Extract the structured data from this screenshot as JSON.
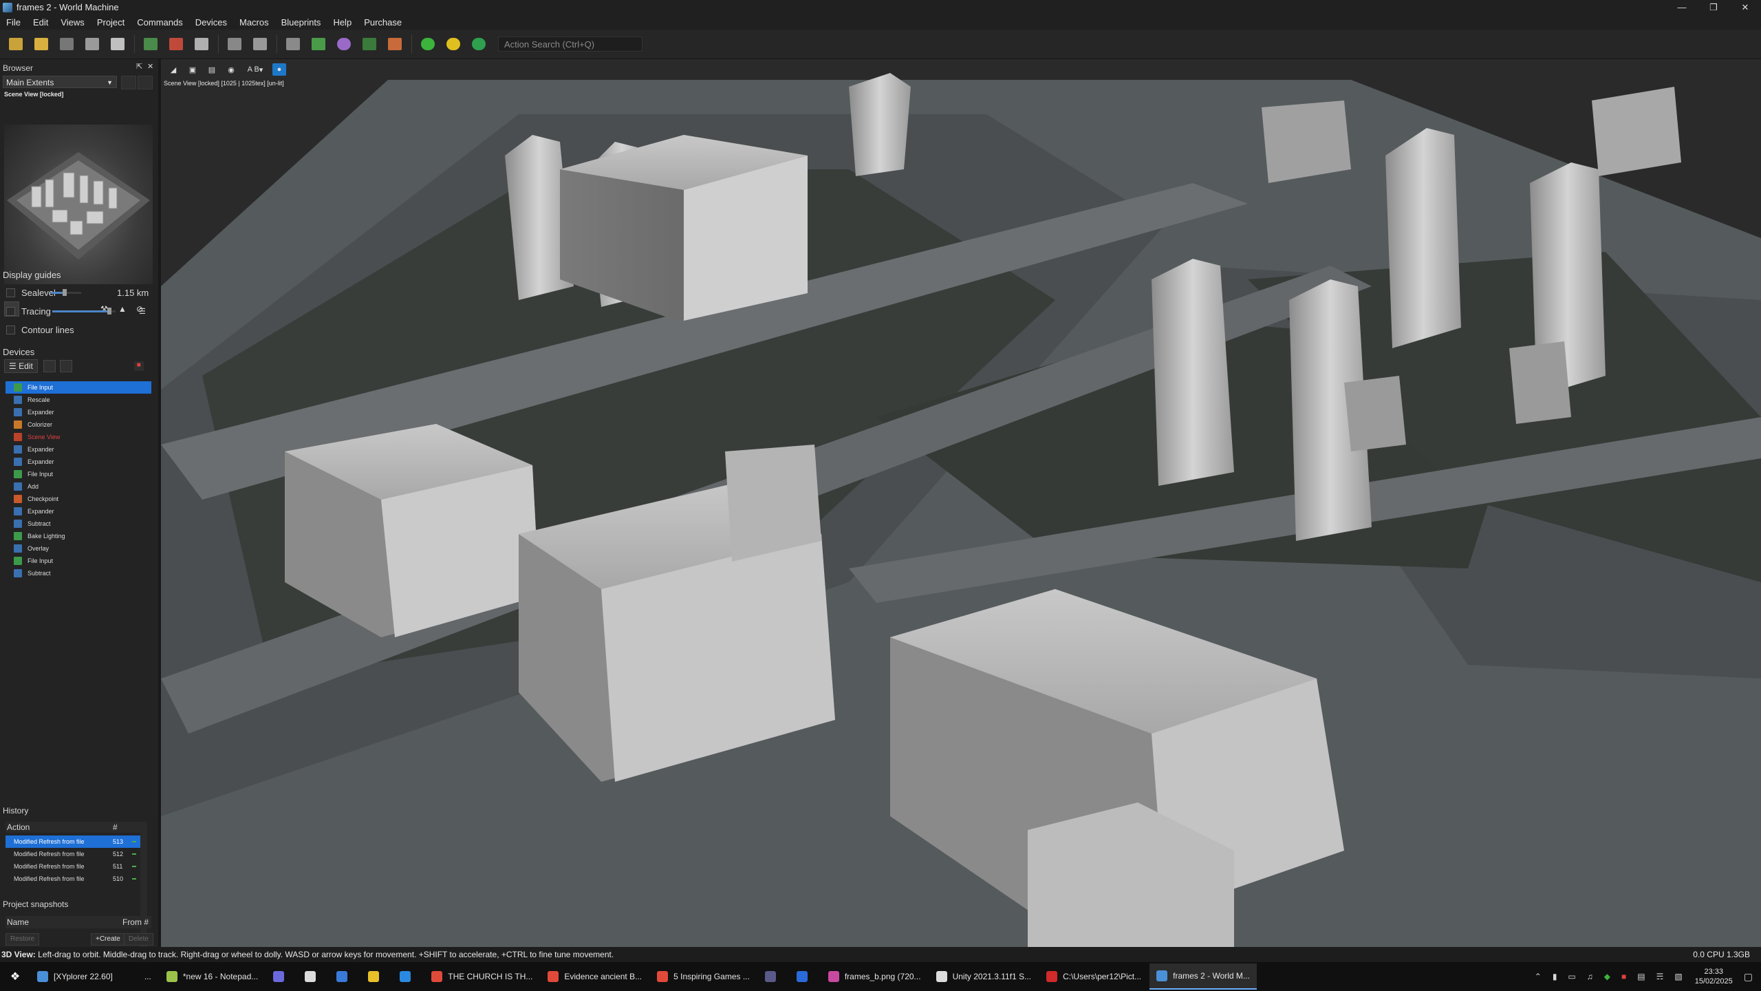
{
  "window": {
    "title": "frames 2 - World Machine"
  },
  "menu": [
    "File",
    "Edit",
    "Views",
    "Project",
    "Commands",
    "Devices",
    "Macros",
    "Blueprints",
    "Help",
    "Purchase"
  ],
  "toolbar": {
    "action_search_placeholder": "Action Search (Ctrl+Q)"
  },
  "browser": {
    "title": "Browser",
    "extents": "Main Extents",
    "preview_label": "Scene View [locked]"
  },
  "guides": {
    "title": "Display guides",
    "sealevel_label": "Sealevel",
    "sealevel_value": "1.15 km",
    "sealevel_level": 0.45,
    "tracing_label": "Tracing",
    "tracing_level": 0.9,
    "contour_label": "Contour lines"
  },
  "devices": {
    "title": "Devices",
    "edit_label": "Edit",
    "items": [
      {
        "label": "File Input",
        "color": "#3c9a4a",
        "selected": true
      },
      {
        "label": "Rescale",
        "color": "#3a6fb0"
      },
      {
        "label": "Expander",
        "color": "#3a6fb0"
      },
      {
        "label": "Colorizer",
        "color": "#c8782a"
      },
      {
        "label": "Scene View",
        "color": "#b8432a",
        "highlight": "#e04040"
      },
      {
        "label": "Expander",
        "color": "#3a6fb0"
      },
      {
        "label": "Expander",
        "color": "#3a6fb0"
      },
      {
        "label": "File Input",
        "color": "#3c9a4a"
      },
      {
        "label": "Add",
        "color": "#3a6fb0"
      },
      {
        "label": "Checkpoint",
        "color": "#c85a2a"
      },
      {
        "label": "Expander",
        "color": "#3a6fb0"
      },
      {
        "label": "Subtract",
        "color": "#3a6fb0"
      },
      {
        "label": "Bake Lighting",
        "color": "#3c9a4a"
      },
      {
        "label": "Overlay",
        "color": "#3a6fb0"
      },
      {
        "label": "File Input",
        "color": "#3c9a4a"
      },
      {
        "label": "Subtract",
        "color": "#3a6fb0"
      }
    ]
  },
  "history": {
    "title": "History",
    "col_action": "Action",
    "col_num": "#",
    "rows": [
      {
        "action": "Modified Refresh from file",
        "num": "513",
        "selected": true
      },
      {
        "action": "Modified Refresh from file",
        "num": "512"
      },
      {
        "action": "Modified Refresh from file",
        "num": "511"
      },
      {
        "action": "Modified Refresh from file",
        "num": "510"
      }
    ]
  },
  "snapshots": {
    "title": "Project snapshots",
    "col_name": "Name",
    "col_from": "From #",
    "restore": "Restore",
    "create": "+Create",
    "delete": "Delete"
  },
  "viewport": {
    "label": "Scene View [locked] [1025 | 1025tex] [un-lit]",
    "ab_label": "A B"
  },
  "status": {
    "mode": "3D View:",
    "hint": " Left-drag to orbit. Middle-drag to track. Right-drag or wheel to dolly. WASD or arrow keys for movement. +SHIFT to accelerate, +CTRL to fine tune movement.",
    "cpu": "0.0 CPU 1.3GB"
  },
  "taskbar": {
    "items": [
      {
        "label": "[XYplorer 22.60]",
        "color": "#4a90d9"
      },
      {
        "label": "...",
        "color": "#101010"
      },
      {
        "label": "*new 16 - Notepad...",
        "color": "#9bc34a"
      },
      {
        "label": "",
        "color": "#6a6adc"
      },
      {
        "label": "",
        "color": "#dcdcdc"
      },
      {
        "label": "",
        "color": "#3a7ad9"
      },
      {
        "label": "",
        "color": "#e8c02a"
      },
      {
        "label": "",
        "color": "#2a8ae0"
      },
      {
        "label": "THE CHURCH IS TH...",
        "color": "#e04a3a"
      },
      {
        "label": "Evidence ancient B...",
        "color": "#e04a3a"
      },
      {
        "label": "5 Inspiring Games ...",
        "color": "#e04a3a"
      },
      {
        "label": "",
        "color": "#5a5a8a"
      },
      {
        "label": "",
        "color": "#2a6ad9"
      },
      {
        "label": "frames_b.png (720...",
        "color": "#c84aa0"
      },
      {
        "label": "Unity 2021.3.11f1 S...",
        "color": "#dcdcdc"
      },
      {
        "label": "C:\\Users\\per12\\Pict...",
        "color": "#d02a2a"
      },
      {
        "label": "frames 2 - World M...",
        "color": "#4a90d9",
        "active": true
      }
    ],
    "time": "23:33",
    "date": "15/02/2025"
  }
}
